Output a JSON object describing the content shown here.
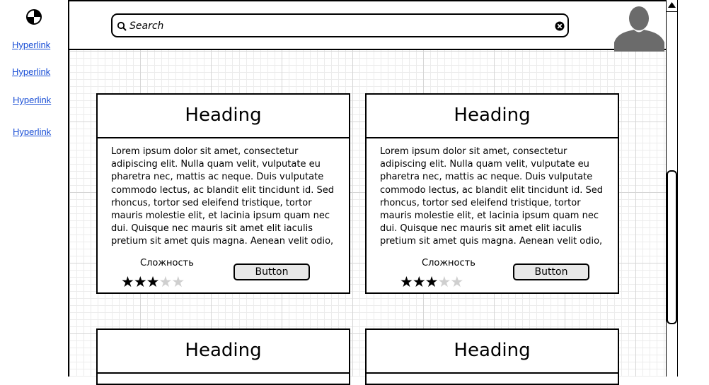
{
  "sidebar": {
    "links": [
      "Hyperlink",
      "Hyperlink",
      "Hyperlink",
      "Hyperlink"
    ]
  },
  "search": {
    "placeholder": "Search"
  },
  "cards": [
    {
      "heading": "Heading",
      "body": "Lorem ipsum dolor sit amet, consectetur adipiscing elit. Nulla quam velit, vulputate eu pharetra nec, mattis ac neque. Duis vulputate commodo lectus, ac blandit elit tincidunt id. Sed rhoncus, tortor sed eleifend tristique, tortor mauris molestie elit, et lacinia ipsum quam nec dui. Quisque nec mauris sit amet elit iaculis pretium sit amet quis magna. Aenean velit odio,",
      "difficulty_label": "Сложность",
      "rating": 3,
      "rating_max": 5,
      "button": "Button"
    },
    {
      "heading": "Heading",
      "body": "Lorem ipsum dolor sit amet, consectetur adipiscing elit. Nulla quam velit, vulputate eu pharetra nec, mattis ac neque. Duis vulputate commodo lectus, ac blandit elit tincidunt id. Sed rhoncus, tortor sed eleifend tristique, tortor mauris molestie elit, et lacinia ipsum quam nec dui. Quisque nec mauris sit amet elit iaculis pretium sit amet quis magna. Aenean velit odio,",
      "difficulty_label": "Сложность",
      "rating": 3,
      "rating_max": 5,
      "button": "Button"
    },
    {
      "heading": "Heading"
    },
    {
      "heading": "Heading"
    }
  ]
}
